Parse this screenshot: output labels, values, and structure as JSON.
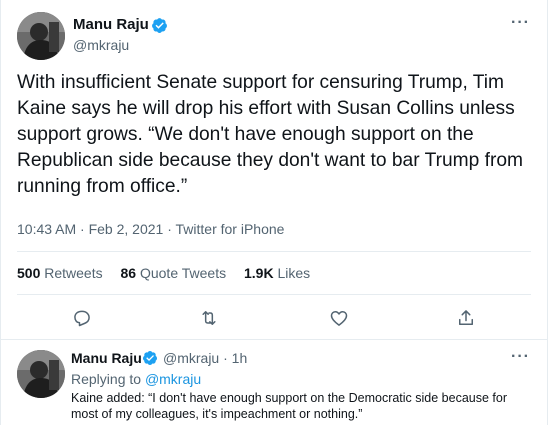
{
  "tweet": {
    "author_name": "Manu Raju",
    "author_handle": "@mkraju",
    "text": "With insufficient Senate support for censuring Trump, Tim Kaine says he will drop his effort with Susan Collins unless support grows. “We don't have enough support on the Republican side because they don't want to bar Trump from running from office.”",
    "time": "10:43 AM · Feb 2, 2021 · Twitter for iPhone",
    "stats": {
      "retweets_count": "500",
      "retweets_label": "Retweets",
      "quotes_count": "86",
      "quotes_label": "Quote Tweets",
      "likes_count": "1.9K",
      "likes_label": "Likes"
    },
    "more_label": "···"
  },
  "reply": {
    "author_name": "Manu Raju",
    "author_handle_time": "@mkraju · 1h",
    "replying_prefix": "Replying to",
    "replying_handle": "@mkraju",
    "text": "Kaine added: “I don't have enough support on the Democratic side because for most of my colleagues, it's impeachment or nothing.”",
    "more_label": "···"
  },
  "colors": {
    "verified": "#1da1f2",
    "link": "#1b95e0",
    "secondary_text": "#536471"
  },
  "icons": [
    "verified-badge-icon",
    "reply-icon",
    "retweet-icon",
    "like-icon",
    "share-icon",
    "more-icon"
  ]
}
